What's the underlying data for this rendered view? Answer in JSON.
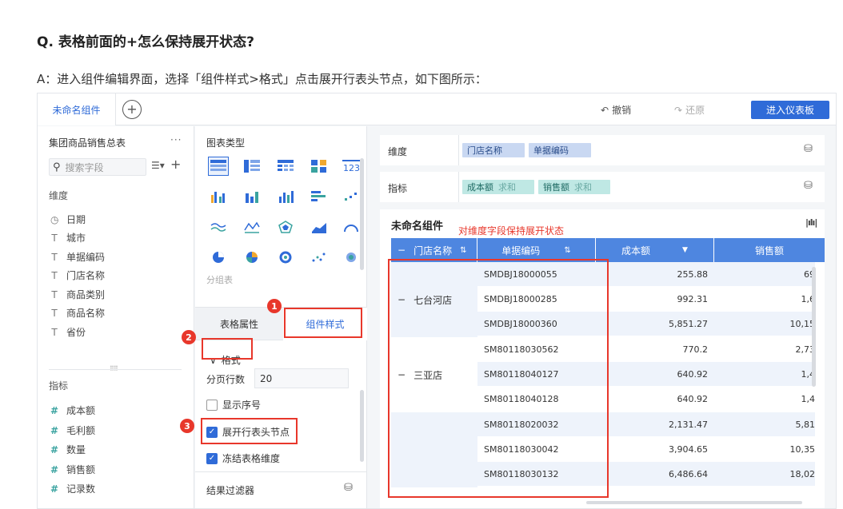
{
  "question": "Q. 表格前面的+怎么保持展开状态?",
  "answer": "A：进入组件编辑界面，选择「组件样式>格式」点击展开行表头节点，如下图所示：",
  "topbar": {
    "tab_label": "未命名组件",
    "add_icon": "plus-circle-icon",
    "undo_label": "撤销",
    "redo_label": "还原",
    "enter_label": "进入仪表板"
  },
  "left": {
    "dataset_title": "集团商品销售总表",
    "more": "···",
    "search_placeholder": "搜索字段",
    "dimension_label": "维度",
    "dimensions": [
      "日期",
      "城市",
      "单据编码",
      "门店名称",
      "商品类别",
      "商品名称",
      "省份"
    ],
    "measure_label": "指标",
    "measures": [
      "成本额",
      "毛利额",
      "数量",
      "销售额",
      "记录数"
    ]
  },
  "middle": {
    "chart_type_label": "图表类型",
    "group_label": "分组表",
    "tab_property": "表格属性",
    "tab_style": "组件样式",
    "format_label": "格式",
    "rows_per_page_label": "分页行数",
    "rows_per_page_value": "20",
    "show_serial_label": "显示序号",
    "show_serial_checked": false,
    "expand_header_label": "展开行表头节点",
    "expand_header_checked": true,
    "freeze_dim_label": "冻结表格维度",
    "freeze_dim_checked": true,
    "filter_label": "结果过滤器"
  },
  "shelves": {
    "dimension_label": "维度",
    "dimension_pills": [
      "门店名称",
      "单据编码"
    ],
    "measure_label": "指标",
    "measure_pills": [
      {
        "name": "成本额",
        "agg": "求和"
      },
      {
        "name": "销售额",
        "agg": "求和"
      }
    ]
  },
  "widget": {
    "title": "未命名组件",
    "note": "对维度字段保持展开状态",
    "headers": [
      "门店名称",
      "单据编码",
      "成本额",
      "销售额"
    ],
    "collapse_symbol": "−",
    "groups": [
      {
        "name": "七台河店",
        "rows": [
          {
            "code": "SMDBJ18000055",
            "cost": "255.88",
            "sales": "69"
          },
          {
            "code": "SMDBJ18000285",
            "cost": "992.31",
            "sales": "1,6"
          },
          {
            "code": "SMDBJ18000360",
            "cost": "5,851.27",
            "sales": "10,15"
          }
        ]
      },
      {
        "name": "三亚店",
        "rows": [
          {
            "code": "SM80118030562",
            "cost": "770.2",
            "sales": "2,73"
          },
          {
            "code": "SM80118040127",
            "cost": "640.92",
            "sales": "1,4"
          },
          {
            "code": "SM80118040128",
            "cost": "640.92",
            "sales": "1,4"
          }
        ]
      },
      {
        "name": "",
        "rows": [
          {
            "code": "SM80118020032",
            "cost": "2,131.47",
            "sales": "5,81"
          },
          {
            "code": "SM80118030042",
            "cost": "3,904.65",
            "sales": "10,35"
          },
          {
            "code": "SM80118030132",
            "cost": "6,486.64",
            "sales": "18,02"
          }
        ]
      }
    ]
  },
  "callouts": [
    "1",
    "2",
    "3"
  ],
  "colors": {
    "accent": "#2f6bd8",
    "header_blue": "#4e86e0",
    "callout_red": "#e8372b",
    "dim_pill": "#c9d8f2",
    "measure_pill": "#bfe8e4"
  }
}
